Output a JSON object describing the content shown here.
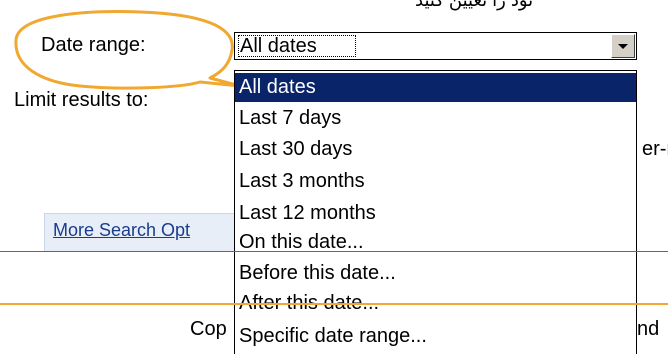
{
  "page": {
    "top_text": "نود را تعیین کنید",
    "date_range_label": "Date range:",
    "limit_results_label": "Limit results to:",
    "partial_right_text": "er-r",
    "more_search_link": "More Search Opt",
    "footer_left_fragment": "Cop",
    "footer_right_fragment": "nd"
  },
  "date_select": {
    "value": "All dates",
    "options": [
      "All dates",
      "Last 7 days",
      "Last 30 days",
      "Last 3 months",
      "Last 12 months",
      "On this date...",
      "Before this date...",
      "After this date...",
      "Specific date range..."
    ],
    "selected_index": 0
  },
  "colors": {
    "callout": "#f0a830",
    "selection": "#0a246a",
    "link": "#1a3c8c"
  }
}
